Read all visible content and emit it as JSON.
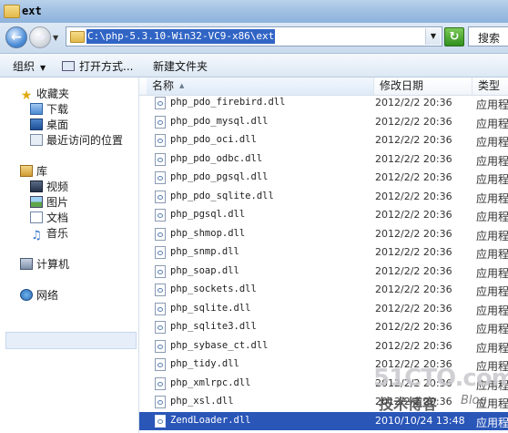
{
  "window": {
    "title": "ext"
  },
  "address_bar": {
    "path": "C:\\php-5.3.10-Win32-VC9-x86\\ext",
    "search_placeholder": "搜索"
  },
  "toolbar": {
    "organize": "组织",
    "open_with": "打开方式...",
    "new_folder": "新建文件夹"
  },
  "nav": {
    "favorites": "收藏夹",
    "downloads": "下载",
    "desktop": "桌面",
    "recent": "最近访问的位置",
    "libraries": "库",
    "videos": "视频",
    "pictures": "图片",
    "documents": "文档",
    "music": "音乐",
    "computer": "计算机",
    "network": "网络"
  },
  "columns": {
    "name": "名称",
    "date": "修改日期",
    "type": "类型"
  },
  "files": [
    {
      "name": "php_pdo_firebird.dll",
      "date": "2012/2/2 20:36",
      "type": "应用程"
    },
    {
      "name": "php_pdo_mysql.dll",
      "date": "2012/2/2 20:36",
      "type": "应用程"
    },
    {
      "name": "php_pdo_oci.dll",
      "date": "2012/2/2 20:36",
      "type": "应用程"
    },
    {
      "name": "php_pdo_odbc.dll",
      "date": "2012/2/2 20:36",
      "type": "应用程"
    },
    {
      "name": "php_pdo_pgsql.dll",
      "date": "2012/2/2 20:36",
      "type": "应用程"
    },
    {
      "name": "php_pdo_sqlite.dll",
      "date": "2012/2/2 20:36",
      "type": "应用程"
    },
    {
      "name": "php_pgsql.dll",
      "date": "2012/2/2 20:36",
      "type": "应用程"
    },
    {
      "name": "php_shmop.dll",
      "date": "2012/2/2 20:36",
      "type": "应用程"
    },
    {
      "name": "php_snmp.dll",
      "date": "2012/2/2 20:36",
      "type": "应用程"
    },
    {
      "name": "php_soap.dll",
      "date": "2012/2/2 20:36",
      "type": "应用程"
    },
    {
      "name": "php_sockets.dll",
      "date": "2012/2/2 20:36",
      "type": "应用程"
    },
    {
      "name": "php_sqlite.dll",
      "date": "2012/2/2 20:36",
      "type": "应用程"
    },
    {
      "name": "php_sqlite3.dll",
      "date": "2012/2/2 20:36",
      "type": "应用程"
    },
    {
      "name": "php_sybase_ct.dll",
      "date": "2012/2/2 20:36",
      "type": "应用程"
    },
    {
      "name": "php_tidy.dll",
      "date": "2012/2/2 20:36",
      "type": "应用程"
    },
    {
      "name": "php_xmlrpc.dll",
      "date": "2012/2/2 20:36",
      "type": "应用程"
    },
    {
      "name": "php_xsl.dll",
      "date": "2012/2/2 20:36",
      "type": "应用程"
    },
    {
      "name": "ZendLoader.dll",
      "date": "2010/10/24 13:48",
      "type": "应用程",
      "selected": true
    }
  ],
  "watermark": {
    "site": "51CTO.com",
    "sub": "技术博客",
    "blog": "Blog"
  }
}
